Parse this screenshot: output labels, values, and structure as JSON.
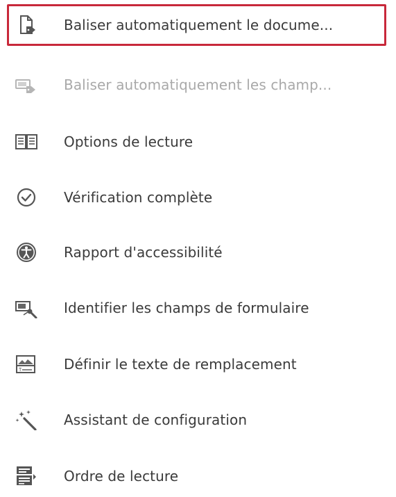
{
  "menu": {
    "items": [
      {
        "label": "Baliser automatiquement le docume...",
        "icon": "tag-document-icon",
        "state": "selected"
      },
      {
        "label": "Baliser automatiquement les champ...",
        "icon": "tag-form-fields-icon",
        "state": "disabled"
      },
      {
        "label": "Options de lecture",
        "icon": "reading-options-icon",
        "state": "normal"
      },
      {
        "label": "Vérification complète",
        "icon": "check-circle-icon",
        "state": "normal"
      },
      {
        "label": "Rapport d'accessibilité",
        "icon": "accessibility-icon",
        "state": "normal"
      },
      {
        "label": "Identifier les champs de formulaire",
        "icon": "identify-form-fields-icon",
        "state": "normal"
      },
      {
        "label": "Définir le texte de remplacement",
        "icon": "alt-text-icon",
        "state": "normal"
      },
      {
        "label": "Assistant de configuration",
        "icon": "magic-wand-icon",
        "state": "normal"
      },
      {
        "label": "Ordre de lecture",
        "icon": "reading-order-icon",
        "state": "normal"
      }
    ]
  },
  "colors": {
    "selection_border": "#c8283a",
    "text": "#3a3a3a",
    "disabled_text": "#a9a9a9",
    "icon": "#5a5a5a"
  }
}
